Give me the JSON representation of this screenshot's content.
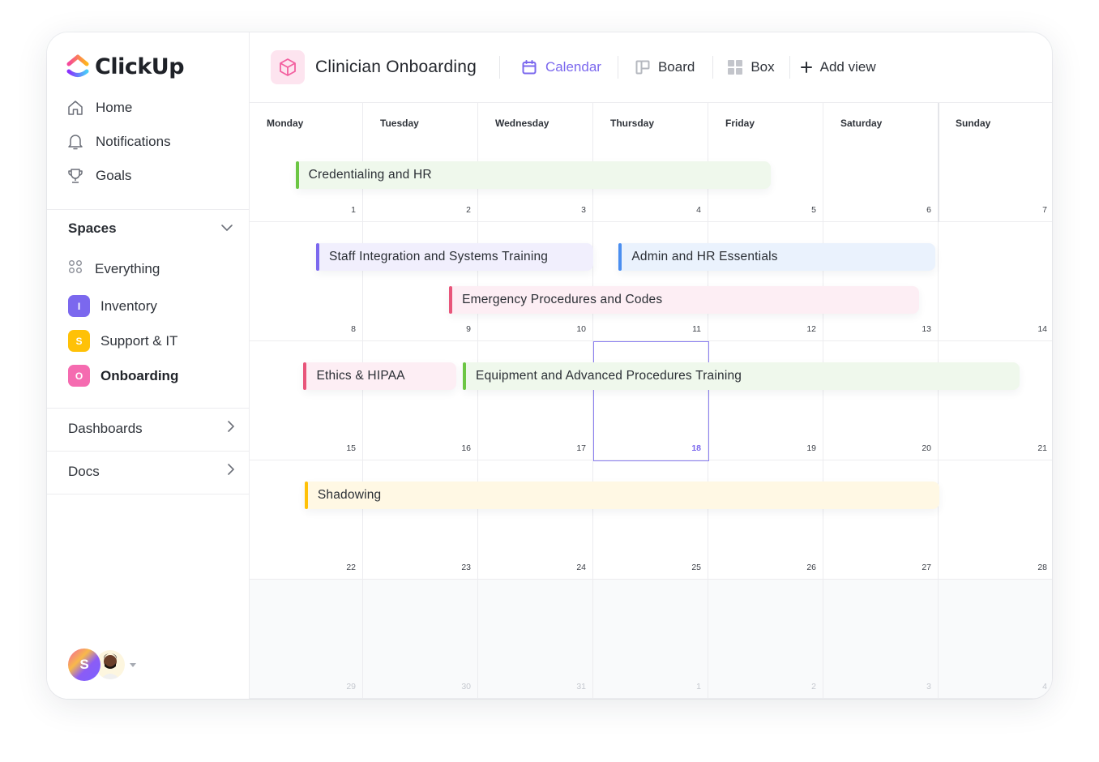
{
  "app": {
    "brand": "ClickUp"
  },
  "sidebar": {
    "nav": [
      {
        "label": "Home",
        "icon": "home-icon"
      },
      {
        "label": "Notifications",
        "icon": "bell-icon"
      },
      {
        "label": "Goals",
        "icon": "trophy-icon"
      }
    ],
    "spaces_label": "Spaces",
    "everything_label": "Everything",
    "spaces": [
      {
        "label": "Inventory",
        "letter": "I",
        "color": "#7b68ee",
        "active": false
      },
      {
        "label": "Support & IT",
        "letter": "S",
        "color": "#ffc107",
        "active": false
      },
      {
        "label": "Onboarding",
        "letter": "O",
        "color": "#f56bb0",
        "active": true
      }
    ],
    "sections": [
      {
        "label": "Dashboards"
      },
      {
        "label": "Docs"
      }
    ],
    "user_avatar_letter": "S"
  },
  "header": {
    "project_title": "Clinician Onboarding",
    "views": [
      {
        "label": "Calendar",
        "icon": "calendar-icon",
        "active": true
      },
      {
        "label": "Board",
        "icon": "board-icon",
        "active": false
      },
      {
        "label": "Box",
        "icon": "box-grid-icon",
        "active": false
      }
    ],
    "add_view_label": "Add view"
  },
  "calendar": {
    "weekdays": [
      "Monday",
      "Tuesday",
      "Wednesday",
      "Thursday",
      "Friday",
      "Saturday",
      "Sunday"
    ],
    "weeks": [
      [
        "1",
        "2",
        "3",
        "4",
        "5",
        "6",
        "7"
      ],
      [
        "8",
        "9",
        "10",
        "11",
        "12",
        "13",
        "14"
      ],
      [
        "15",
        "16",
        "17",
        "18",
        "19",
        "20",
        "21"
      ],
      [
        "22",
        "23",
        "24",
        "25",
        "26",
        "27",
        "28"
      ],
      [
        "29",
        "30",
        "31",
        "1",
        "2",
        "3",
        "4"
      ]
    ],
    "today": "18",
    "events": [
      {
        "title": "Credentialing and HR",
        "week": 0,
        "start_day": 0.4,
        "end_day": 4.55,
        "lane": 0,
        "accent": "#6cc644",
        "bg": "#eff8ec"
      },
      {
        "title": "Staff Integration and Systems Training",
        "week": 1,
        "start_day": 0.58,
        "end_day": 3.0,
        "lane": 0,
        "accent": "#7b68ee",
        "bg": "#f1effd"
      },
      {
        "title": "Admin and HR Essentials",
        "week": 1,
        "start_day": 3.22,
        "end_day": 5.98,
        "lane": 0,
        "accent": "#4a8ef0",
        "bg": "#eaf2fd"
      },
      {
        "title": "Emergency Procedures and Codes",
        "week": 1,
        "start_day": 1.74,
        "end_day": 5.84,
        "lane": 1,
        "accent": "#e8557a",
        "bg": "#fdeef4"
      },
      {
        "title": "Ethics & HIPAA",
        "week": 2,
        "start_day": 0.47,
        "end_day": 1.8,
        "lane": 0,
        "accent": "#e8557a",
        "bg": "#fdeef4"
      },
      {
        "title": "Equipment and Advanced Procedures Training",
        "week": 2,
        "start_day": 1.86,
        "end_day": 6.72,
        "lane": 0,
        "accent": "#6cc644",
        "bg": "#eff8ec"
      },
      {
        "title": "Shadowing",
        "week": 3,
        "start_day": 0.48,
        "end_day": 6.02,
        "lane": 0,
        "accent": "#ffc107",
        "bg": "#fff8e4"
      }
    ]
  }
}
